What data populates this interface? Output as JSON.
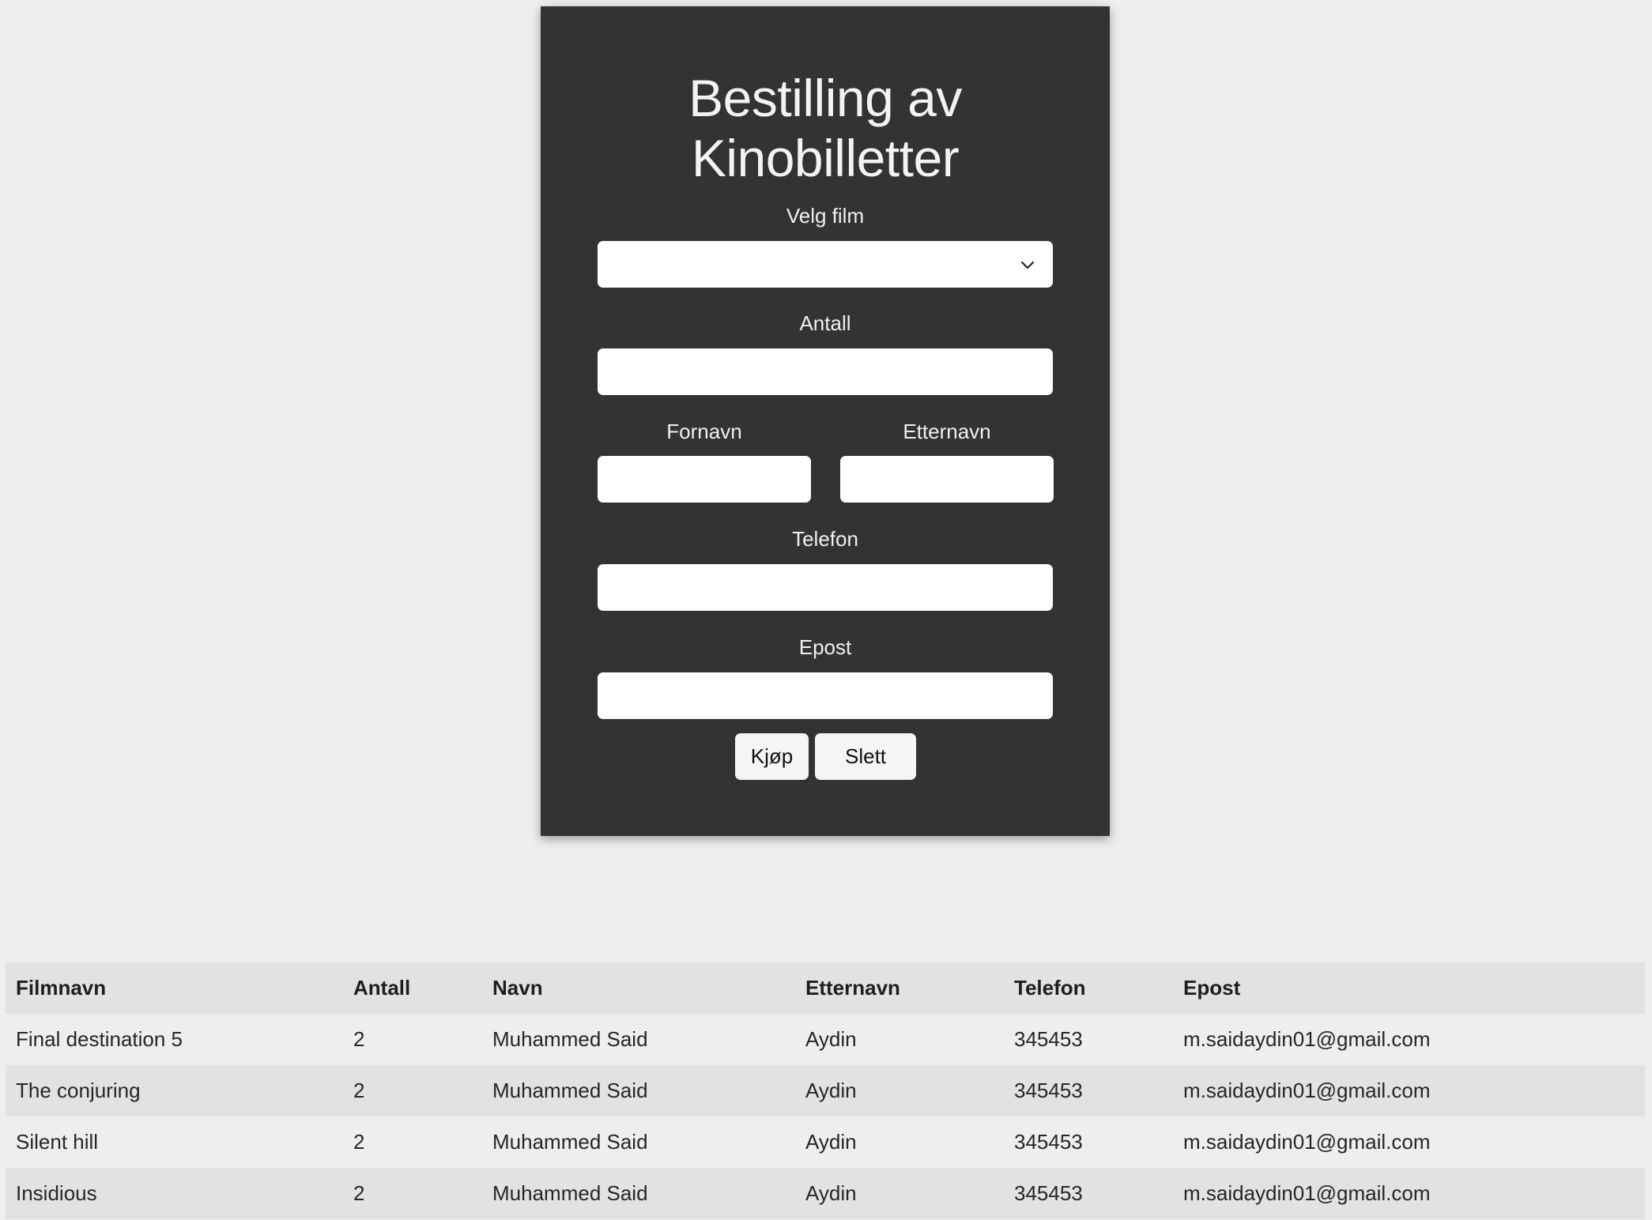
{
  "form": {
    "title_line1": "Bestilling av",
    "title_line2": "Kinobilletter",
    "film_label": "Velg film",
    "film_selected": "",
    "antall_label": "Antall",
    "antall_value": "",
    "fornavn_label": "Fornavn",
    "fornavn_value": "",
    "etternavn_label": "Etternavn",
    "etternavn_value": "",
    "telefon_label": "Telefon",
    "telefon_value": "",
    "epost_label": "Epost",
    "epost_value": "",
    "buy_label": "Kjøp",
    "delete_label": "Slett",
    "select_icon": "chevron-down-icon"
  },
  "table": {
    "headers": [
      "Filmnavn",
      "Antall",
      "Navn",
      "Etternavn",
      "Telefon",
      "Epost"
    ],
    "rows": [
      [
        "Final destination 5",
        "2",
        "Muhammed Said",
        "Aydin",
        "345453",
        "m.saidaydin01@gmail.com"
      ],
      [
        "The conjuring",
        "2",
        "Muhammed Said",
        "Aydin",
        "345453",
        "m.saidaydin01@gmail.com"
      ],
      [
        "Silent hill",
        "2",
        "Muhammed Said",
        "Aydin",
        "345453",
        "m.saidaydin01@gmail.com"
      ],
      [
        "Insidious",
        "2",
        "Muhammed Said",
        "Aydin",
        "345453",
        "m.saidaydin01@gmail.com"
      ]
    ]
  },
  "colors": {
    "page_background": "#eeeeee",
    "card_background": "#333333",
    "card_text": "#f0f0f0",
    "input_background": "#ffffff",
    "button_background": "#f5f5f5",
    "table_row_light": "#eeeeee",
    "table_row_dark": "#e2e2e2"
  }
}
